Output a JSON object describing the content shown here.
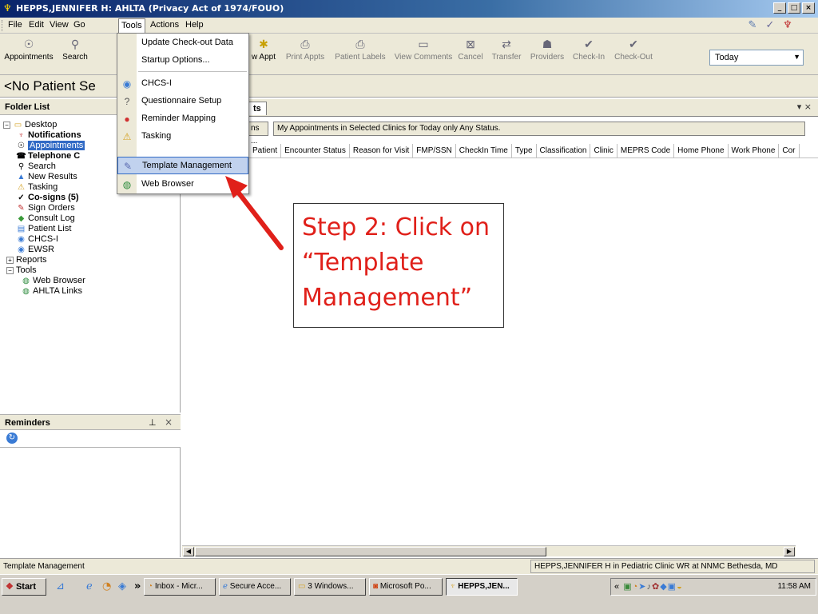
{
  "window": {
    "title": "HEPPS,JENNIFER H: AHLTA  (Privacy Act of 1974/FOUO)",
    "min": "_",
    "max": "□",
    "close": "×"
  },
  "menu": {
    "file": "File",
    "edit": "Edit",
    "view": "View",
    "go": "Go",
    "tools": "Tools",
    "actions": "Actions",
    "help": "Help"
  },
  "toolbar": {
    "appointments": "Appointments",
    "search": "Search",
    "new_appt": "w Appt",
    "print_appts": "Print Appts",
    "patient_labels": "Patient Labels",
    "view_comments": "View Comments",
    "cancel": "Cancel",
    "transfer": "Transfer",
    "providers": "Providers",
    "check_in": "Check-In",
    "check_out": "Check-Out",
    "date_select": "Today"
  },
  "patient": {
    "name": "<No Patient Se"
  },
  "folder_list": {
    "title": "Folder List",
    "items": [
      {
        "label": "Desktop"
      },
      {
        "label": "Notifications"
      },
      {
        "label": "Appointments"
      },
      {
        "label": "Telephone C"
      },
      {
        "label": "Search"
      },
      {
        "label": "New Results"
      },
      {
        "label": "Tasking"
      },
      {
        "label": "Co-signs (5)"
      },
      {
        "label": "Sign Orders"
      },
      {
        "label": "Consult Log"
      },
      {
        "label": "Patient List"
      },
      {
        "label": "CHCS-I"
      },
      {
        "label": "EWSR"
      },
      {
        "label": "Reports"
      },
      {
        "label": "Tools"
      },
      {
        "label": "Web Browser"
      },
      {
        "label": "AHLTA Links"
      }
    ]
  },
  "reminders": {
    "title": "Reminders"
  },
  "right_panel": {
    "tab_label": "ts",
    "controls": "▾ ×",
    "filter_btn": "ns ...",
    "filter_text": "My Appointments in Selected Clinics for Today only  Any Status.",
    "columns": [
      "Patient",
      "Encounter Status",
      "Reason for Visit",
      "FMP/SSN",
      "CheckIn Time",
      "Type",
      "Classification",
      "Clinic",
      "MEPRS Code",
      "Home Phone",
      "Work Phone",
      "Cor"
    ]
  },
  "tools_menu": {
    "items": [
      {
        "label": "Update Check-out Data"
      },
      {
        "label": "Startup Options..."
      },
      {
        "label": "CHCS-I"
      },
      {
        "label": "Questionnaire Setup"
      },
      {
        "label": "Reminder Mapping"
      },
      {
        "label": "Tasking"
      },
      {
        "label": "Template Management"
      },
      {
        "label": "Web Browser"
      }
    ]
  },
  "callout": {
    "text": "Step 2: Click on “Template Management”",
    "color": "#e0201a"
  },
  "status": {
    "left": "Template Management",
    "right": "HEPPS,JENNIFER H in Pediatric Clinic WR at NNMC Bethesda, MD"
  },
  "taskbar": {
    "start": "Start",
    "chevron": "»",
    "tasks": [
      {
        "label": "Inbox - Micr..."
      },
      {
        "label": "Secure Acce..."
      },
      {
        "label": "3 Windows..."
      },
      {
        "label": "Microsoft Po..."
      },
      {
        "label": "HEPPS,JEN..."
      }
    ],
    "tray_chevron": "«",
    "clock": "11:58 AM"
  }
}
